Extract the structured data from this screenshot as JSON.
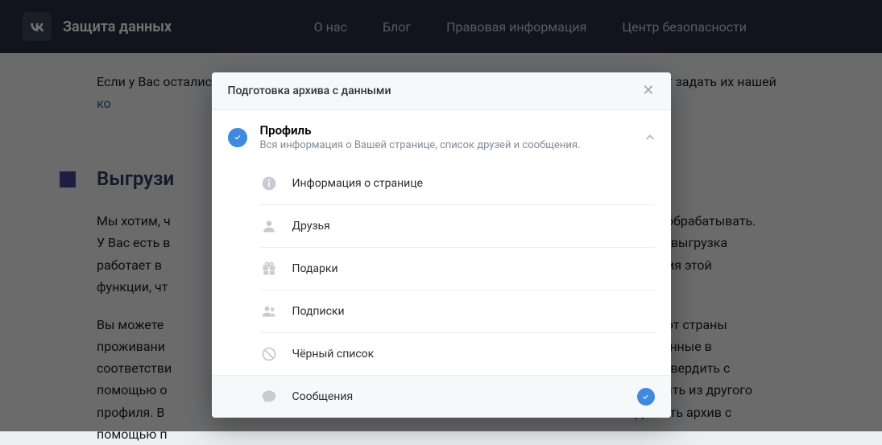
{
  "header": {
    "brand": "Защита данных",
    "nav": {
      "about": "О нас",
      "blog": "Блог",
      "legal": "Правовая информация",
      "safety": "Центр безопасности"
    }
  },
  "page": {
    "para1_a": "Если у Вас остались вопросы касательно приватности ВКонтакте, Вы можете в любой момент задать их нашей ",
    "para1_link": "ко",
    "section_heading": "Выгрузи",
    "para2": "Мы хотим, ч\nУ Вас есть в\nработает в\nфункции, чт",
    "para2_tail_a": "ть или обрабатывать.",
    "para2_tail_b": " Сейчас выгрузка",
    "para2_tail_c": "твования этой",
    "para3_left": "Вы можете\nпроживани\nсоответстви\nпомощью о\nпрофиля. В\nпомощью п",
    "para3_tail_a": "исимо от страны",
    "para3_tail_b": "сить данные в",
    "para3_tail_c": "но подтвердить с",
    "para3_tail_d": "о открыть из другого",
    "para3_tail_e": "ифровать архив с"
  },
  "modal": {
    "title": "Подготовка архива с данными",
    "section": {
      "name": "Профиль",
      "desc": "Вся информация о Вашей странице, список друзей и сообщения."
    },
    "items": {
      "info": "Информация о странице",
      "friends": "Друзья",
      "gifts": "Подарки",
      "subscriptions": "Подписки",
      "blacklist": "Чёрный список",
      "messages": "Сообщения"
    }
  }
}
